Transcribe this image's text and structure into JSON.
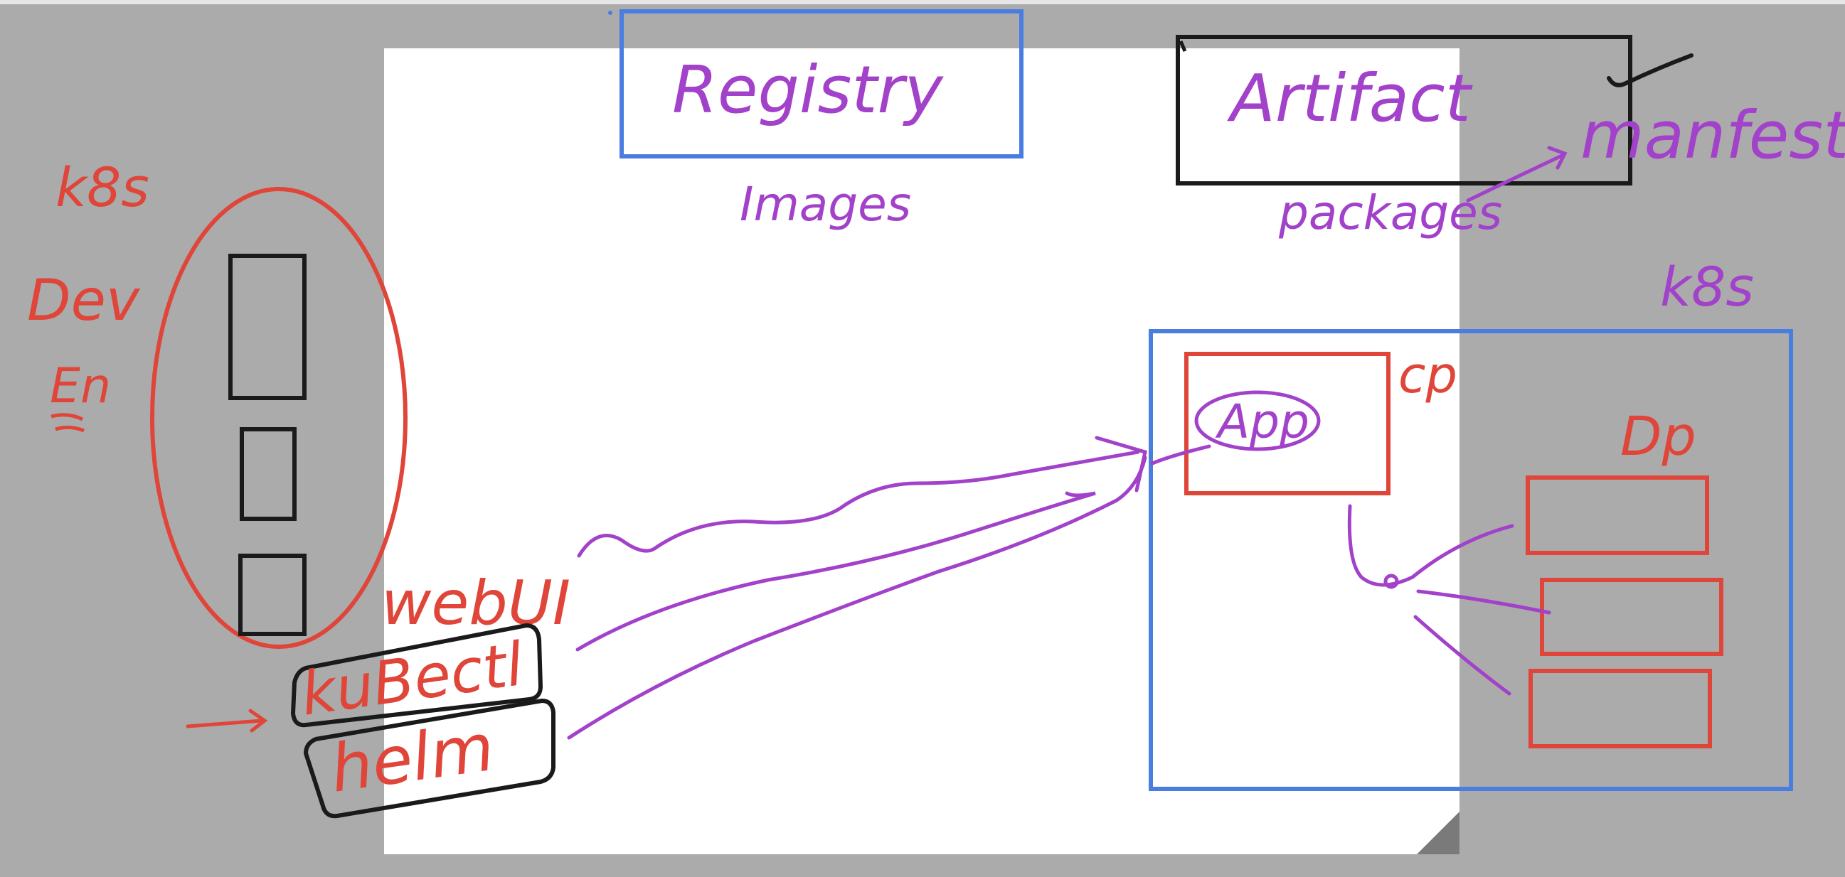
{
  "colors": {
    "board": "#ababab",
    "page": "#ffffff",
    "blue_box": "#4a7de0",
    "black_box": "#1a1a1a",
    "red_ink": "#e0453a",
    "purple_ink": "#a241c9"
  },
  "labels": {
    "registry": "Registry",
    "images": "Images",
    "artifact": "Artifact",
    "packages": "packages",
    "manifest": "manfest",
    "k8s_left": "k8s",
    "dev": "Dev",
    "env": "En",
    "k8s_right": "k8s",
    "app": "App",
    "cp": "cp",
    "dp": "Dp",
    "webui": "webUI",
    "kubectl": "kuBectl",
    "helm": "helm"
  }
}
